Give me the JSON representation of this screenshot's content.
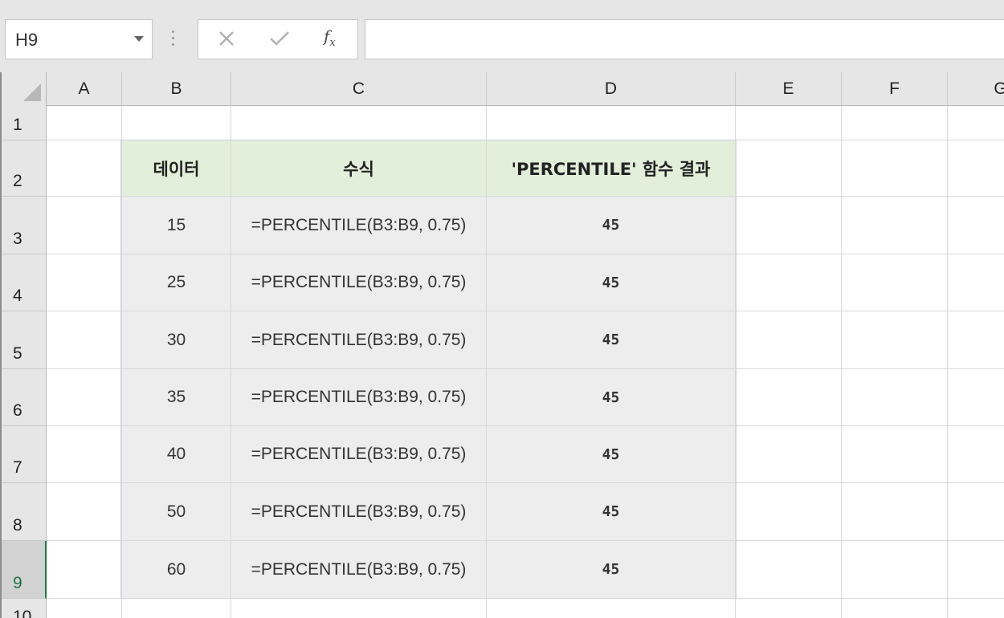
{
  "formula_bar": {
    "name_box": "H9",
    "cancel_icon": "close-icon",
    "enter_icon": "check-icon",
    "function_label": "fx",
    "formula_value": ""
  },
  "columns": [
    "A",
    "B",
    "C",
    "D",
    "E",
    "F",
    "G"
  ],
  "rows": [
    "1",
    "2",
    "3",
    "4",
    "5",
    "6",
    "7",
    "8",
    "9",
    "10"
  ],
  "selected_row": "9",
  "table": {
    "headers": [
      "데이터",
      "수식",
      "'PERCENTILE' 함수 결과"
    ],
    "data": [
      {
        "value": "15",
        "formula": "=PERCENTILE(B3:B9, 0.75)",
        "result": "45"
      },
      {
        "value": "25",
        "formula": "=PERCENTILE(B3:B9, 0.75)",
        "result": "45"
      },
      {
        "value": "30",
        "formula": "=PERCENTILE(B3:B9, 0.75)",
        "result": "45"
      },
      {
        "value": "35",
        "formula": "=PERCENTILE(B3:B9, 0.75)",
        "result": "45"
      },
      {
        "value": "40",
        "formula": "=PERCENTILE(B3:B9, 0.75)",
        "result": "45"
      },
      {
        "value": "50",
        "formula": "=PERCENTILE(B3:B9, 0.75)",
        "result": "45"
      },
      {
        "value": "60",
        "formula": "=PERCENTILE(B3:B9, 0.75)",
        "result": "45"
      }
    ]
  },
  "colors": {
    "header_fill": "#e2efda",
    "body_fill": "#ededed",
    "selection": "#217346"
  }
}
